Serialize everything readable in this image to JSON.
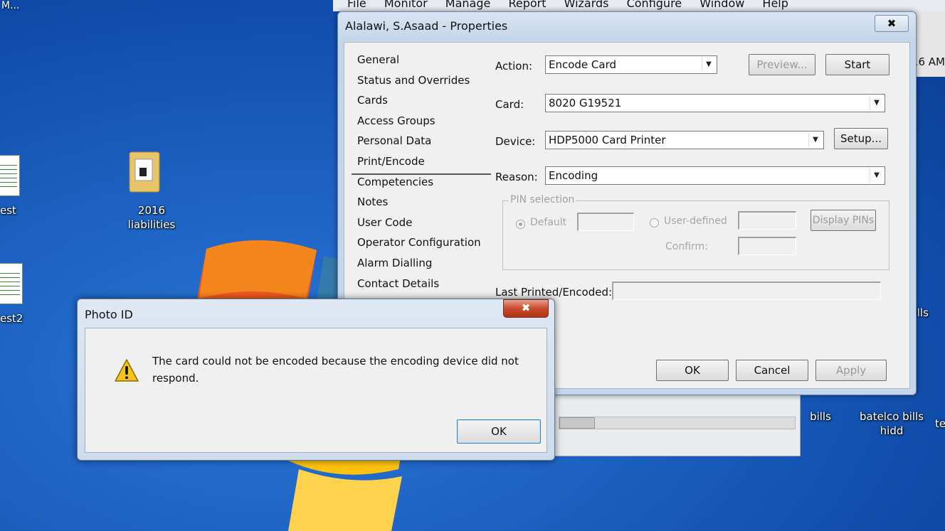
{
  "desktop": {
    "top_left_text": "M...",
    "icons": [
      {
        "label": "est"
      },
      {
        "label": "est2"
      },
      {
        "label": "2016 liabilities"
      },
      {
        "label": "bills"
      },
      {
        "label": "bills"
      },
      {
        "label": "batelco bills hidd"
      },
      {
        "label": "te"
      }
    ],
    "clock_fragment": ":16 AM"
  },
  "app": {
    "menu": [
      "File",
      "Monitor",
      "Manage",
      "Report",
      "Wizards",
      "Configure",
      "Window",
      "Help"
    ]
  },
  "properties": {
    "title": "Alalawi, S.Asaad - Properties",
    "close_glyph": "✖",
    "nav": [
      "General",
      "Status and Overrides",
      "Cards",
      "Access Groups",
      "Personal Data",
      "Print/Encode",
      "Competencies",
      "Notes",
      "User Code",
      "Operator Configuration",
      "Alarm Dialling",
      "Contact Details"
    ],
    "action_label": "Action:",
    "action_value": "Encode Card",
    "preview_label": "Preview...",
    "start_label": "Start",
    "card_label": "Card:",
    "card_value": "8020 G19521",
    "device_label": "Device:",
    "device_value": "HDP5000 Card Printer",
    "setup_label": "Setup...",
    "reason_label": "Reason:",
    "reason_value": "Encoding",
    "pin_group_label": "PIN selection",
    "default_label": "Default",
    "user_defined_label": "User-defined",
    "display_pins_label": "Display PINs",
    "confirm_label": "Confirm:",
    "last_printed_label": "Last Printed/Encoded:",
    "ok_label": "OK",
    "cancel_label": "Cancel",
    "apply_label": "Apply"
  },
  "error_dialog": {
    "title": "Photo ID",
    "close_glyph": "✖",
    "message": "The card could not be encoded because the encoding device did not respond.",
    "ok_label": "OK",
    "icon": "warning-icon"
  }
}
